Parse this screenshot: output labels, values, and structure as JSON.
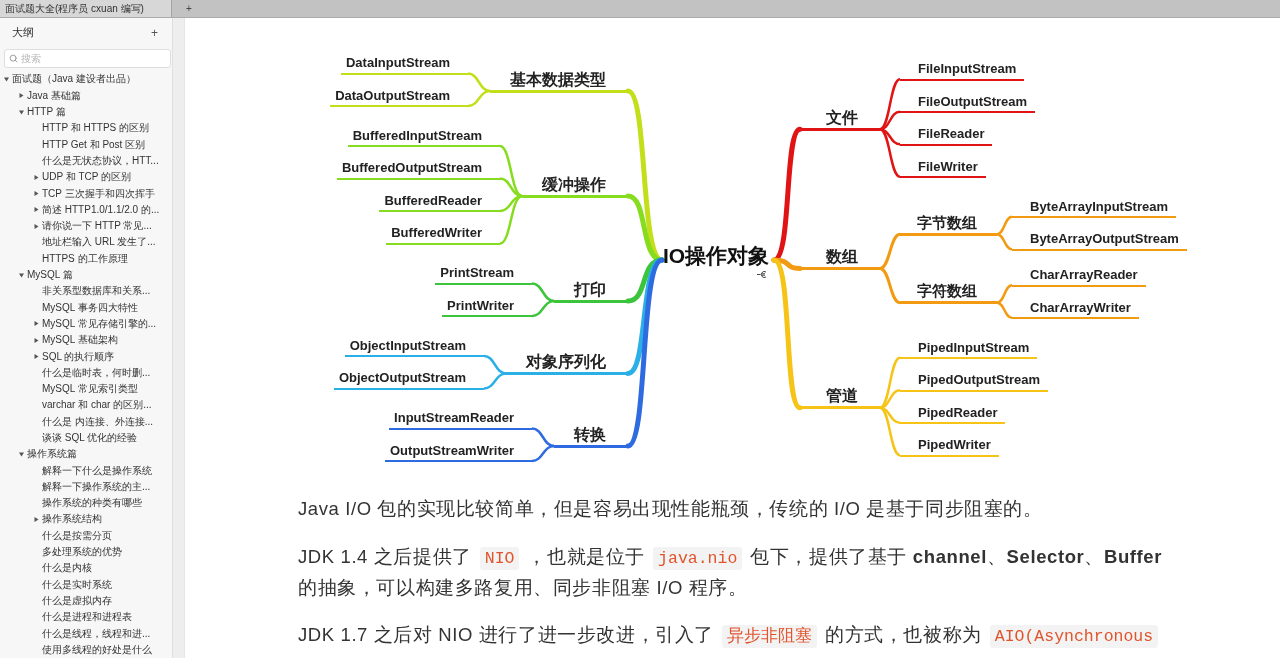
{
  "tab_bar": {
    "tabs": [
      {
        "label": "面试题大全(程序员 cxuan 编写)",
        "selected": true
      }
    ],
    "new_tab": "+"
  },
  "sidebar": {
    "title": "大纲",
    "add": "+",
    "search": {
      "placeholder": "搜索"
    },
    "tree": [
      {
        "label": "面试题（Java 建设者出品）",
        "expanded": true,
        "children": [
          {
            "label": "Java 基础篇",
            "expanded": false
          },
          {
            "label": "HTTP 篇",
            "expanded": true,
            "children": [
              {
                "label": "HTTP 和 HTTPS 的区别"
              },
              {
                "label": "HTTP Get 和 Post 区别"
              },
              {
                "label": "什么是无状态协议，HTT..."
              },
              {
                "label": "UDP 和 TCP 的区别",
                "expanded": false
              },
              {
                "label": "TCP 三次握手和四次挥手",
                "expanded": false
              },
              {
                "label": "简述 HTTP1.0/1.1/2.0 的...",
                "expanded": false
              },
              {
                "label": "请你说一下 HTTP 常见...",
                "expanded": false
              },
              {
                "label": "地址栏输入 URL 发生了..."
              },
              {
                "label": "HTTPS 的工作原理"
              }
            ]
          },
          {
            "label": "MySQL 篇",
            "expanded": true,
            "children": [
              {
                "label": "非关系型数据库和关系..."
              },
              {
                "label": "MySQL 事务四大特性"
              },
              {
                "label": "MySQL 常见存储引擎的...",
                "expanded": false
              },
              {
                "label": "MySQL 基础架构",
                "expanded": false
              },
              {
                "label": "SQL 的执行顺序",
                "expanded": false
              },
              {
                "label": "什么是临时表，何时删..."
              },
              {
                "label": "MySQL 常见索引类型"
              },
              {
                "label": "varchar 和 char 的区别..."
              },
              {
                "label": "什么是 内连接、外连接..."
              },
              {
                "label": "谈谈 SQL 优化的经验"
              }
            ]
          },
          {
            "label": "操作系统篇",
            "expanded": true,
            "children": [
              {
                "label": "解释一下什么是操作系统"
              },
              {
                "label": "解释一下操作系统的主..."
              },
              {
                "label": "操作系统的种类有哪些"
              },
              {
                "label": "操作系统结构",
                "expanded": false
              },
              {
                "label": "什么是按需分页"
              },
              {
                "label": "多处理系统的优势"
              },
              {
                "label": "什么是内核"
              },
              {
                "label": "什么是实时系统"
              },
              {
                "label": "什么是虚拟内存"
              },
              {
                "label": "什么是进程和进程表"
              },
              {
                "label": "什么是线程，线程和进..."
              },
              {
                "label": "使用多线程的好处是什么"
              }
            ]
          }
        ]
      }
    ]
  },
  "mindmap": {
    "center": "IO操作对象",
    "left": [
      {
        "label": "基本数据类型",
        "color": "#c3df1a",
        "children": [
          {
            "label": "DataInputStream"
          },
          {
            "label": "DataOutputStream"
          }
        ]
      },
      {
        "label": "缓冲操作",
        "color": "#86dc1e",
        "children": [
          {
            "label": "BufferedInputStream"
          },
          {
            "label": "BufferedOutputStream"
          },
          {
            "label": "BufferedReader"
          },
          {
            "label": "BufferedWriter"
          }
        ]
      },
      {
        "label": "打印",
        "color": "#3cc43c",
        "children": [
          {
            "label": "PrintStream"
          },
          {
            "label": "PrintWriter"
          }
        ]
      },
      {
        "label": "对象序列化",
        "color": "#2ab0e6",
        "children": [
          {
            "label": "ObjectInputStream"
          },
          {
            "label": "ObjectOutputStream"
          }
        ]
      },
      {
        "label": "转换",
        "color": "#2e6ae0",
        "children": [
          {
            "label": "InputStreamReader"
          },
          {
            "label": "OutputStreamWriter"
          }
        ]
      }
    ],
    "right": [
      {
        "label": "文件",
        "color": "#e01414",
        "children": [
          {
            "label": "FileInputStream"
          },
          {
            "label": "FileOutputStream"
          },
          {
            "label": "FileReader"
          },
          {
            "label": "FileWriter"
          }
        ]
      },
      {
        "label": "数组",
        "color": "#f29a12",
        "children": [
          {
            "label": "字节数组",
            "children": [
              {
                "label": "ByteArrayInputStream"
              },
              {
                "label": "ByteArrayOutputStream"
              }
            ]
          },
          {
            "label": "字符数组",
            "children": [
              {
                "label": "CharArrayReader"
              },
              {
                "label": "CharArrayWriter"
              }
            ]
          }
        ]
      },
      {
        "label": "管道",
        "color": "#f6c416",
        "children": [
          {
            "label": "PipedInputStream"
          },
          {
            "label": "PipedOutputStream"
          },
          {
            "label": "PipedReader"
          },
          {
            "label": "PipedWriter"
          }
        ]
      }
    ]
  },
  "article": {
    "paragraphs": [
      {
        "segments": [
          {
            "kind": "text",
            "text": "Java I/O 包的实现比较简单，但是容易出现性能瓶颈，传统的 I/O 是基于同步阻塞的。"
          }
        ]
      },
      {
        "segments": [
          {
            "kind": "text",
            "text": "JDK 1.4 之后提供了"
          },
          {
            "kind": "code",
            "text": "NIO"
          },
          {
            "kind": "text",
            "text": "，也就是位于"
          },
          {
            "kind": "code",
            "text": "java.nio"
          },
          {
            "kind": "text",
            "text": "包下，提供了基于 **channel**、**Selector**、**Buffer** 的抽象，可以构建多路复用、同步非阻塞 I/O 程序。"
          }
        ]
      },
      {
        "segments": [
          {
            "kind": "text",
            "text": "JDK 1.7 之后对 NIO 进行了进一步改进，引入了"
          },
          {
            "kind": "code",
            "text": "异步非阻塞"
          },
          {
            "kind": "text",
            "text": "的方式，也被称为"
          },
          {
            "kind": "code",
            "text": "AIO(Asynchronous"
          }
        ]
      }
    ]
  }
}
